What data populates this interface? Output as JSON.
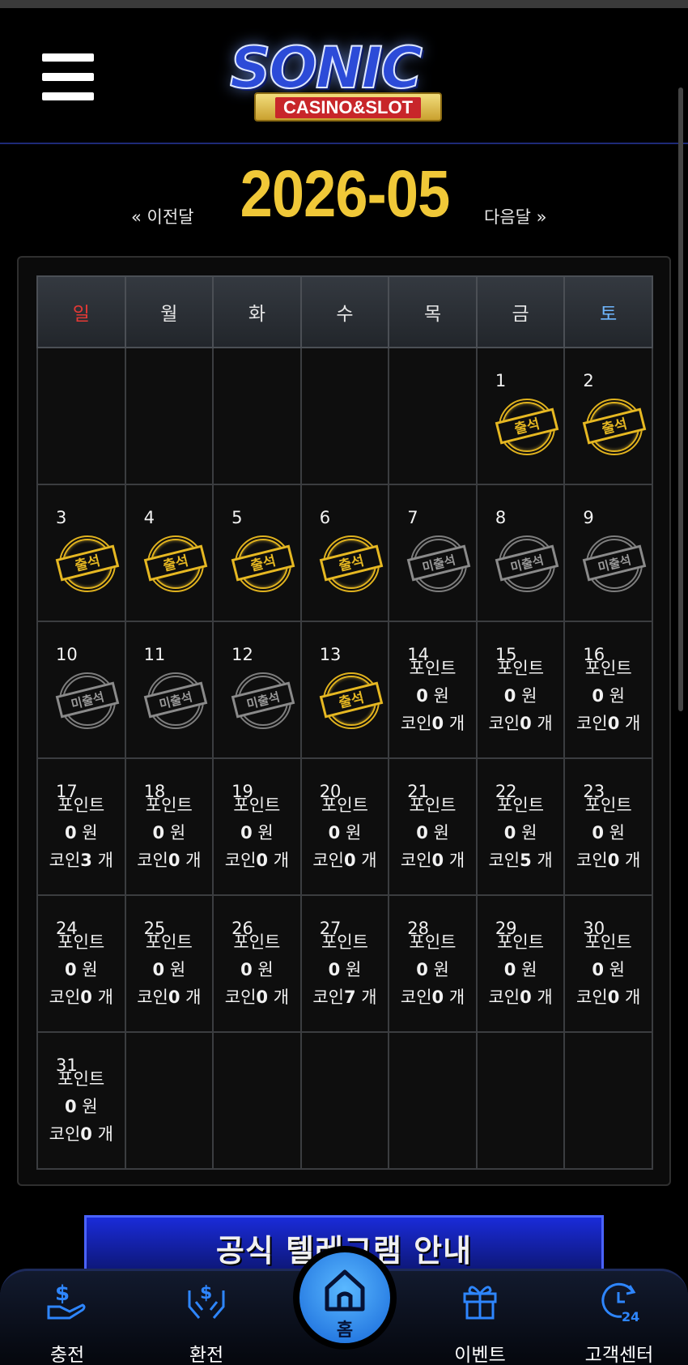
{
  "header": {
    "logo_main": "SONIC",
    "logo_sub": "CASINO&SLOT"
  },
  "nav": {
    "prev": "« 이전달",
    "title": "2026-05",
    "next": "다음달 »"
  },
  "weekdays": [
    "일",
    "월",
    "화",
    "수",
    "목",
    "금",
    "토"
  ],
  "stamps": {
    "attended": "출석",
    "absent": "미출석"
  },
  "info_labels": {
    "point": "포인트",
    "won": "원",
    "coin": "코인",
    "unit": "개"
  },
  "days": {
    "1": {
      "status": "attended"
    },
    "2": {
      "status": "attended"
    },
    "3": {
      "status": "attended"
    },
    "4": {
      "status": "attended"
    },
    "5": {
      "status": "attended"
    },
    "6": {
      "status": "attended"
    },
    "7": {
      "status": "absent"
    },
    "8": {
      "status": "absent"
    },
    "9": {
      "status": "absent"
    },
    "10": {
      "status": "absent"
    },
    "11": {
      "status": "absent"
    },
    "12": {
      "status": "absent"
    },
    "13": {
      "status": "attended"
    },
    "14": {
      "point": "0",
      "coin": "0"
    },
    "15": {
      "point": "0",
      "coin": "0"
    },
    "16": {
      "point": "0",
      "coin": "0"
    },
    "17": {
      "point": "0",
      "coin": "3"
    },
    "18": {
      "point": "0",
      "coin": "0"
    },
    "19": {
      "point": "0",
      "coin": "0"
    },
    "20": {
      "point": "0",
      "coin": "0"
    },
    "21": {
      "point": "0",
      "coin": "0"
    },
    "22": {
      "point": "0",
      "coin": "5"
    },
    "23": {
      "point": "0",
      "coin": "0"
    },
    "24": {
      "point": "0",
      "coin": "0"
    },
    "25": {
      "point": "0",
      "coin": "0"
    },
    "26": {
      "point": "0",
      "coin": "0"
    },
    "27": {
      "point": "0",
      "coin": "7"
    },
    "28": {
      "point": "0",
      "coin": "0"
    },
    "29": {
      "point": "0",
      "coin": "0"
    },
    "30": {
      "point": "0",
      "coin": "0"
    },
    "31": {
      "point": "0",
      "coin": "0"
    }
  },
  "banner": "공식 텔레그램 안내",
  "bottom_nav": {
    "deposit": "충전",
    "withdraw": "환전",
    "home": "홈",
    "event": "이벤트",
    "support": "고객센터"
  },
  "colors": {
    "accent_gold": "#f0c838",
    "sunday": "#e53935",
    "saturday": "#6fb7ff",
    "nav_icon": "#2e86ff"
  }
}
